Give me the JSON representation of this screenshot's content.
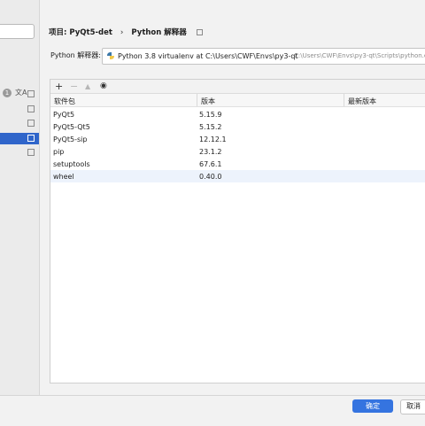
{
  "header": {
    "project_label": "项目: PyQt5-det",
    "separator": "›",
    "section": "Python 解释器"
  },
  "sidebar": {
    "badge": "1",
    "lang_glyph": "文A"
  },
  "interpreter": {
    "label": "Python 解释器:",
    "name": "Python 3.8 virtualenv at C:\\Users\\CWF\\Envs\\py3-qt",
    "path": "C:\\Users\\CWF\\Envs\\py3-qt\\Scripts\\python.e"
  },
  "toolbar": {
    "add": "+",
    "remove": "−",
    "upgrade": "▲",
    "show": "◉"
  },
  "table": {
    "columns": [
      "软件包",
      "版本",
      "最新版本"
    ],
    "rows": [
      {
        "name": "PyQt5",
        "version": "5.15.9",
        "latest": ""
      },
      {
        "name": "PyQt5-Qt5",
        "version": "5.15.2",
        "latest": ""
      },
      {
        "name": "PyQt5-sip",
        "version": "12.12.1",
        "latest": ""
      },
      {
        "name": "pip",
        "version": "23.1.2",
        "latest": ""
      },
      {
        "name": "setuptools",
        "version": "67.6.1",
        "latest": ""
      },
      {
        "name": "wheel",
        "version": "0.40.0",
        "latest": ""
      }
    ]
  },
  "footer": {
    "ok_label": "确定",
    "cancel_label": "取消"
  }
}
